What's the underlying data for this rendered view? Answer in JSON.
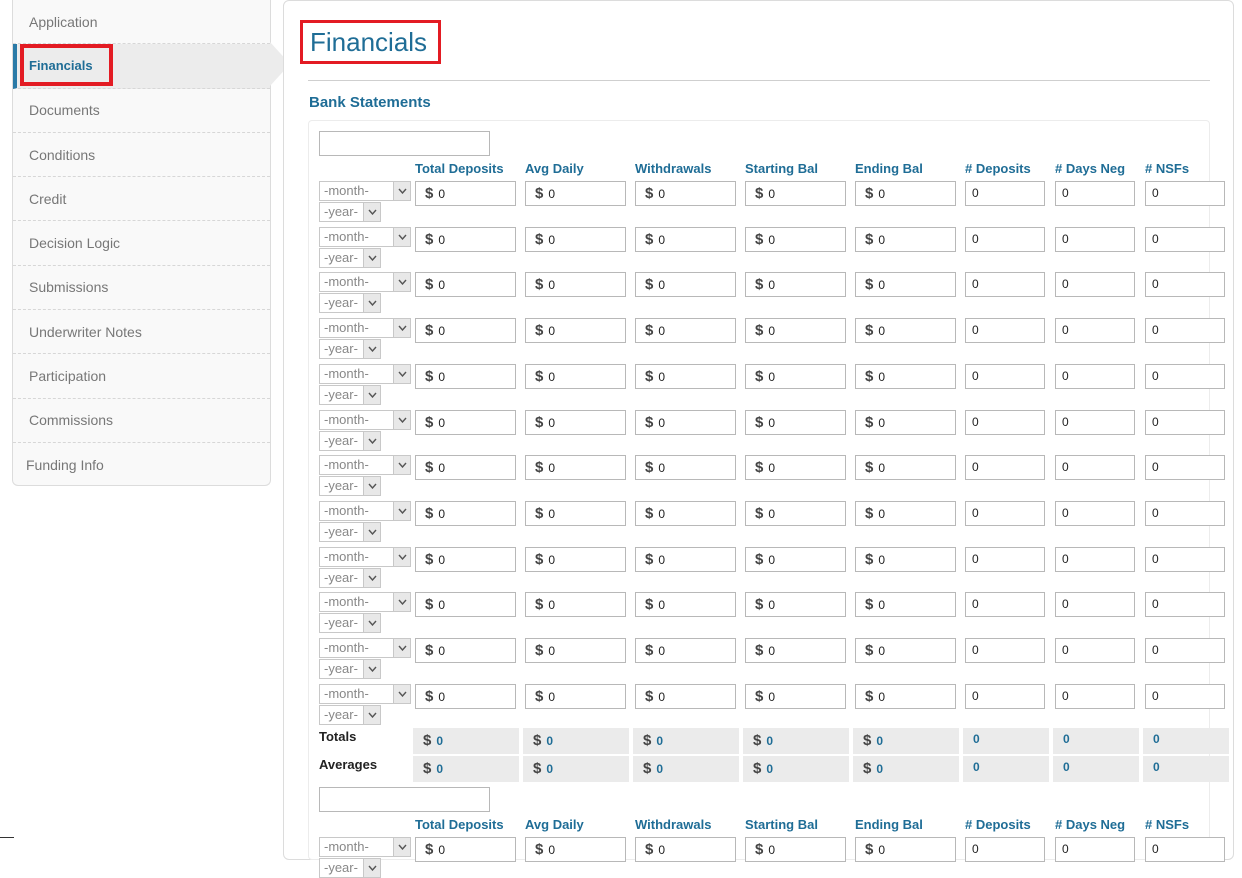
{
  "sidebar": {
    "items": [
      {
        "label": "Application",
        "active": false
      },
      {
        "label": "Financials",
        "active": true
      },
      {
        "label": "Documents",
        "active": false
      },
      {
        "label": "Conditions",
        "active": false
      },
      {
        "label": "Credit",
        "active": false
      },
      {
        "label": "Decision Logic",
        "active": false
      },
      {
        "label": "Submissions",
        "active": false
      },
      {
        "label": "Underwriter Notes",
        "active": false
      },
      {
        "label": "Participation",
        "active": false
      },
      {
        "label": "Commissions",
        "active": false
      },
      {
        "label": "Funding Info",
        "active": false
      }
    ]
  },
  "main": {
    "title": "Financials",
    "section_title": "Bank Statements",
    "columns": [
      "Total Deposits",
      "Avg Daily",
      "Withdrawals",
      "Starting Bal",
      "Ending Bal",
      "# Deposits",
      "# Days Neg",
      "# NSFs"
    ],
    "currency_symbol": "$",
    "month_placeholder": "-month-",
    "year_placeholder": "-year-",
    "row_values": [
      "0",
      "0",
      "0",
      "0",
      "0",
      "0",
      "0",
      "0"
    ],
    "totals_label": "Totals",
    "averages_label": "Averages",
    "totals_values": [
      "0",
      "0",
      "0",
      "0",
      "0",
      "0",
      "0",
      "0"
    ],
    "averages_values": [
      "0",
      "0",
      "0",
      "0",
      "0",
      "0",
      "0",
      "0"
    ]
  },
  "colors": {
    "accent": "#1f6d96",
    "highlight": "#e31b23",
    "summary_bg": "#ebebeb"
  }
}
